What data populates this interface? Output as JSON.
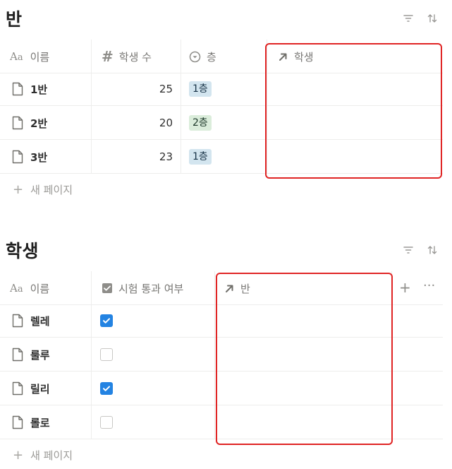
{
  "class_db": {
    "title": "반",
    "columns": [
      {
        "icon": "text-icon",
        "label": "이름"
      },
      {
        "icon": "number-icon",
        "label": "학생 수"
      },
      {
        "icon": "select-icon",
        "label": "층"
      },
      {
        "icon": "relation-arrow-icon",
        "label": "학생"
      }
    ],
    "rows": [
      {
        "name": "1반",
        "count": "25",
        "floor": "1층",
        "floor_color": "#d3e5ef"
      },
      {
        "name": "2반",
        "count": "20",
        "floor": "2층",
        "floor_color": "#dbeddb"
      },
      {
        "name": "3반",
        "count": "23",
        "floor": "1층",
        "floor_color": "#d3e5ef"
      }
    ],
    "new_page": "새 페이지"
  },
  "student_db": {
    "title": "학생",
    "columns": [
      {
        "icon": "text-icon",
        "label": "이름"
      },
      {
        "icon": "checkbox-icon",
        "label": "시험 통과 여부"
      },
      {
        "icon": "relation-arrow-icon",
        "label": "반"
      }
    ],
    "rows": [
      {
        "name": "렐레",
        "passed": true
      },
      {
        "name": "룰루",
        "passed": false
      },
      {
        "name": "릴리",
        "passed": true
      },
      {
        "name": "롤로",
        "passed": false
      }
    ],
    "new_page": "새 페이지"
  },
  "colors": {
    "highlight": "#e02424",
    "checkbox_on": "#2383e2"
  },
  "text_icon_label": "Aa"
}
